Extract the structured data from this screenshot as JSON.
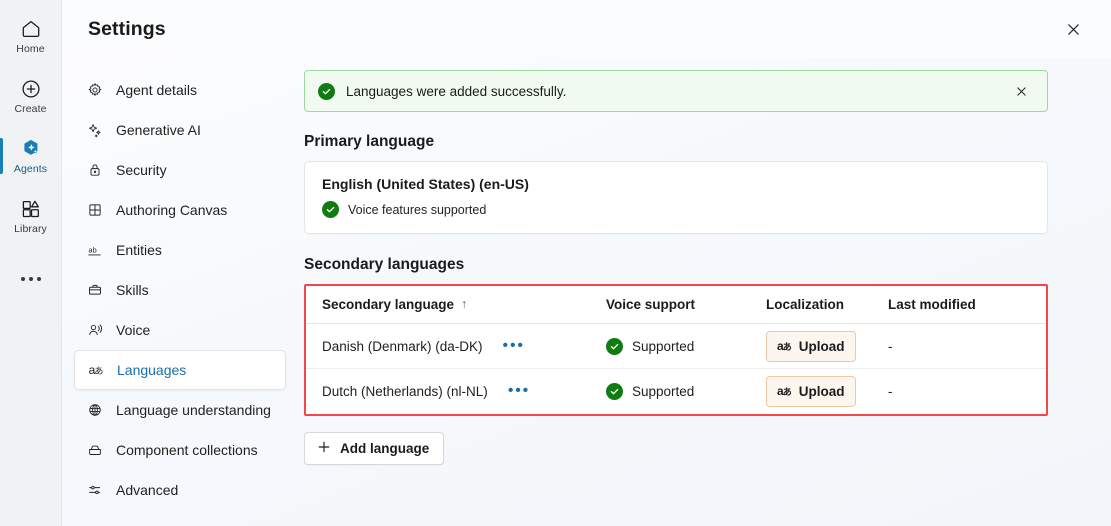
{
  "rail": {
    "items": [
      {
        "label": "Home",
        "icon": "home-icon",
        "active": false
      },
      {
        "label": "Create",
        "icon": "plus-circle-icon",
        "active": false
      },
      {
        "label": "Agents",
        "icon": "agents-icon",
        "active": true
      },
      {
        "label": "Library",
        "icon": "library-icon",
        "active": false
      }
    ],
    "overflow_icon": "more-dots-icon"
  },
  "panel": {
    "title": "Settings",
    "close_icon": "close-icon"
  },
  "settings_nav": {
    "items": [
      {
        "label": "Agent details",
        "icon": "gear-icon",
        "active": false
      },
      {
        "label": "Generative AI",
        "icon": "sparkle-icon",
        "active": false
      },
      {
        "label": "Security",
        "icon": "lock-icon",
        "active": false
      },
      {
        "label": "Authoring Canvas",
        "icon": "grid-icon",
        "active": false
      },
      {
        "label": "Entities",
        "icon": "ab-icon",
        "active": false
      },
      {
        "label": "Skills",
        "icon": "briefcase-icon",
        "active": false
      },
      {
        "label": "Voice",
        "icon": "voice-icon",
        "active": false
      },
      {
        "label": "Languages",
        "icon": "language-icon",
        "active": true
      },
      {
        "label": "Language understanding",
        "icon": "globe-brain-icon",
        "active": false
      },
      {
        "label": "Component collections",
        "icon": "collection-icon",
        "active": false
      },
      {
        "label": "Advanced",
        "icon": "sliders-icon",
        "active": false
      }
    ]
  },
  "banner": {
    "message": "Languages were added successfully.",
    "status_icon": "success-check-icon",
    "close_icon": "close-icon",
    "background": "#f1faf1",
    "border": "#9fd89f",
    "accent": "#107c10"
  },
  "primary_language": {
    "heading": "Primary language",
    "name": "English (United States) (en-US)",
    "voice_status": "Voice features supported",
    "voice_status_icon": "success-check-icon"
  },
  "secondary_languages": {
    "heading": "Secondary languages",
    "highlight_color": "#f4474a",
    "columns": [
      {
        "label": "Secondary language",
        "sorted": true,
        "sort_icon": "arrow-up-icon"
      },
      {
        "label": "Voice support"
      },
      {
        "label": "Localization"
      },
      {
        "label": "Last modified"
      }
    ],
    "rows": [
      {
        "language": "Danish (Denmark) (da-DK)",
        "more_icon": "ellipsis-icon",
        "voice_support": "Supported",
        "voice_support_icon": "success-check-icon",
        "localization_label": "Upload",
        "localization_icon": "localization-icon",
        "last_modified": "-"
      },
      {
        "language": "Dutch (Netherlands) (nl-NL)",
        "more_icon": "ellipsis-icon",
        "voice_support": "Supported",
        "voice_support_icon": "success-check-icon",
        "localization_label": "Upload",
        "localization_icon": "localization-icon",
        "last_modified": "-"
      }
    ],
    "add_button": {
      "label": "Add language",
      "icon": "plus-icon"
    }
  }
}
